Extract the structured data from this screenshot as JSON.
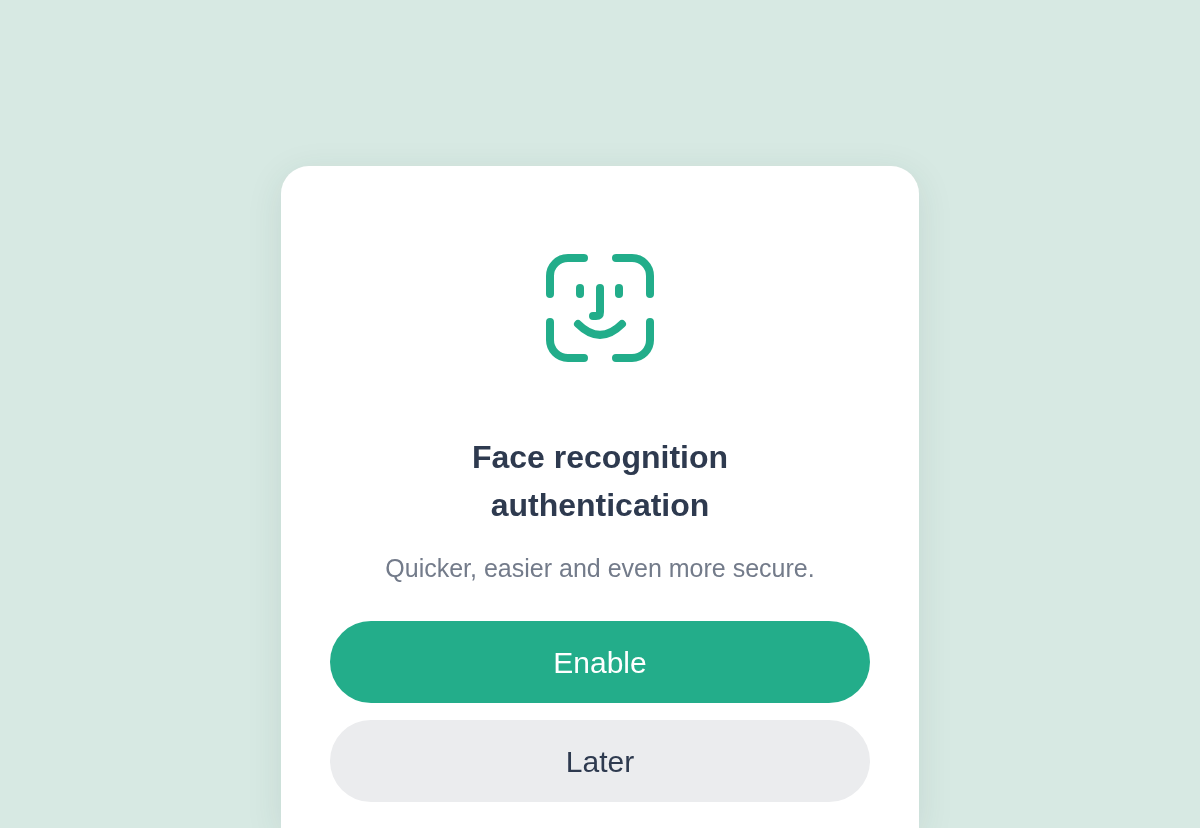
{
  "dialog": {
    "title": "Face recognition authentication",
    "subtitle": "Quicker, easier and even more secure.",
    "buttons": [
      {
        "label": "Enable",
        "kind": "primary"
      },
      {
        "label": "Later",
        "kind": "secondary"
      }
    ]
  }
}
